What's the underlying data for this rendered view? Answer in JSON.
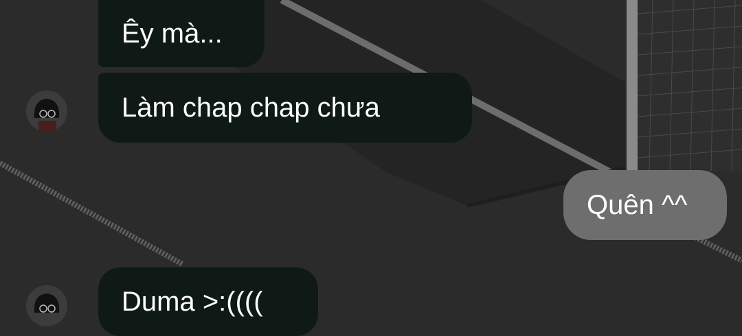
{
  "chat": {
    "messages": [
      {
        "sender": "other",
        "text": "Êy mà..."
      },
      {
        "sender": "other",
        "text": "Làm chap chap chưa"
      },
      {
        "sender": "me",
        "text": "Quên ^^"
      },
      {
        "sender": "other",
        "text": "Duma >:(((("
      }
    ]
  },
  "colors": {
    "incoming_bubble": "#0f1a17",
    "outgoing_bubble": "#6e6e6e",
    "text": "#ffffff",
    "background": "#2b2b2b"
  },
  "icons": [
    "avatar-sticker"
  ]
}
